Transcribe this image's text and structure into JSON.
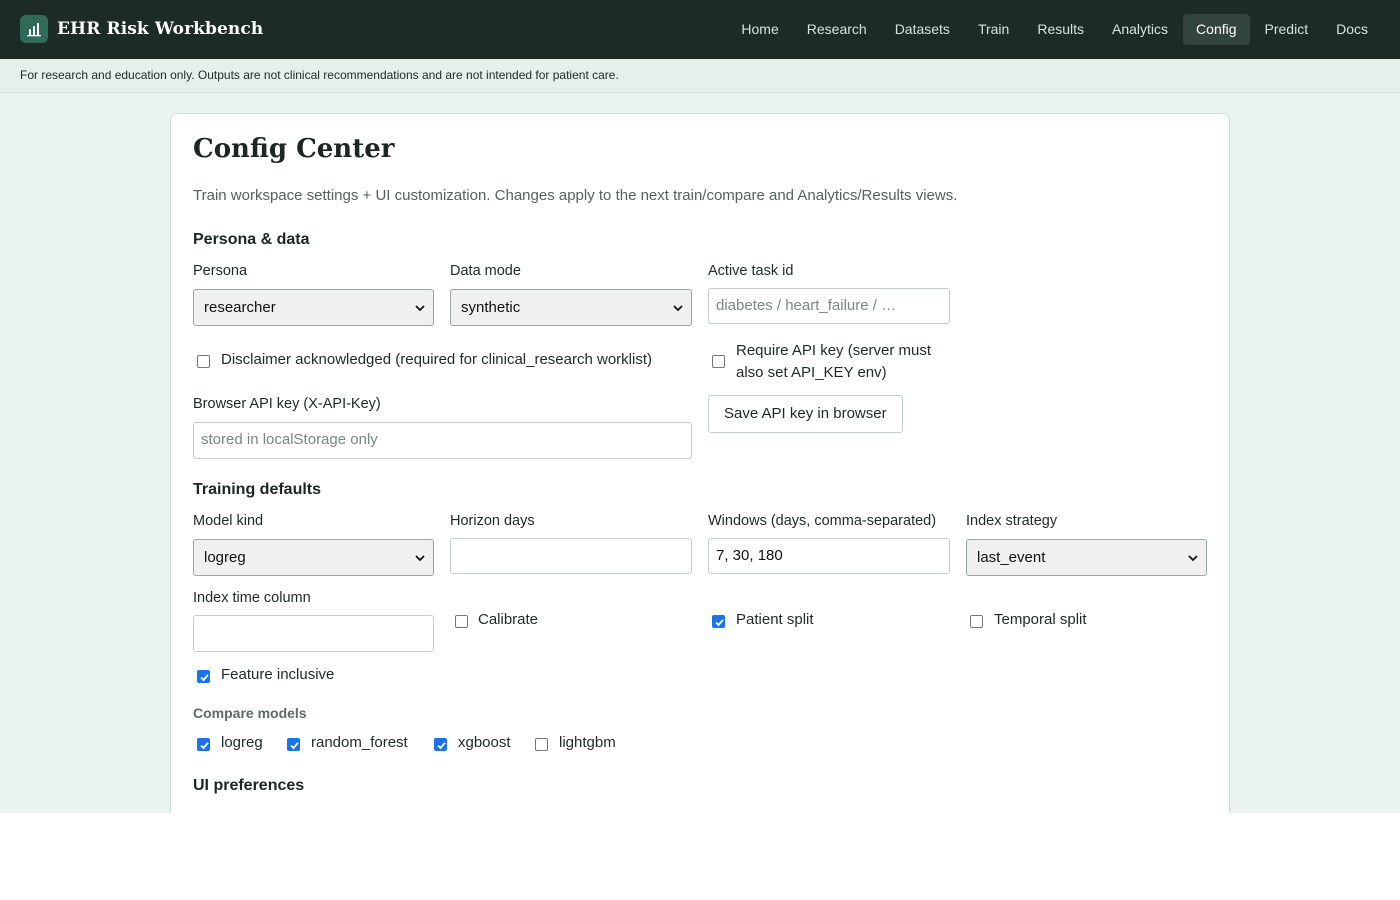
{
  "app": {
    "title": "EHR Risk Workbench",
    "logo_icon": "bar-chart-icon"
  },
  "nav": {
    "items": [
      {
        "label": "Home",
        "active": false
      },
      {
        "label": "Research",
        "active": false
      },
      {
        "label": "Datasets",
        "active": false
      },
      {
        "label": "Train",
        "active": false
      },
      {
        "label": "Results",
        "active": false
      },
      {
        "label": "Analytics",
        "active": false
      },
      {
        "label": "Config",
        "active": true
      },
      {
        "label": "Predict",
        "active": false
      },
      {
        "label": "Docs",
        "active": false
      }
    ]
  },
  "disclaimer": "For research and education only. Outputs are not clinical recommendations and are not intended for patient care.",
  "page": {
    "title": "Config Center",
    "subtitle": "Train workspace settings + UI customization. Changes apply to the next train/compare and Analytics/Results views."
  },
  "persona_section": {
    "heading": "Persona & data",
    "persona": {
      "label": "Persona",
      "value": "researcher"
    },
    "data_mode": {
      "label": "Data mode",
      "value": "synthetic"
    },
    "active_task": {
      "label": "Active task id",
      "value": "",
      "placeholder": "diabetes / heart_failure / …"
    },
    "disclaimer_ack": {
      "label": "Disclaimer acknowledged (required for clinical_research worklist)",
      "checked": false
    },
    "require_api_key": {
      "label_line1": "Require API key (server must",
      "label_line2": "also set API_KEY env)",
      "checked": false
    },
    "browser_api_key": {
      "label": "Browser API key (X-API-Key)",
      "value": "",
      "placeholder": "stored in localStorage only"
    },
    "save_button": "Save API key in browser"
  },
  "training_section": {
    "heading": "Training defaults",
    "model_kind": {
      "label": "Model kind",
      "value": "logreg"
    },
    "horizon_days": {
      "label": "Horizon days",
      "value": ""
    },
    "windows": {
      "label": "Windows (days, comma-separated)",
      "value": "7, 30, 180"
    },
    "index_strategy": {
      "label": "Index strategy",
      "value": "last_event"
    },
    "index_time_column": {
      "label": "Index time column",
      "value": ""
    },
    "calibrate": {
      "label": "Calibrate",
      "checked": false
    },
    "patient_split": {
      "label": "Patient split",
      "checked": true
    },
    "temporal_split": {
      "label": "Temporal split",
      "checked": false
    },
    "feature_inclusive": {
      "label": "Feature inclusive",
      "checked": true
    },
    "compare_models": {
      "label": "Compare models",
      "options": [
        {
          "label": "logreg",
          "checked": true
        },
        {
          "label": "random_forest",
          "checked": true
        },
        {
          "label": "xgboost",
          "checked": true
        },
        {
          "label": "lightgbm",
          "checked": false
        }
      ]
    }
  },
  "ui_section": {
    "heading": "UI preferences"
  }
}
